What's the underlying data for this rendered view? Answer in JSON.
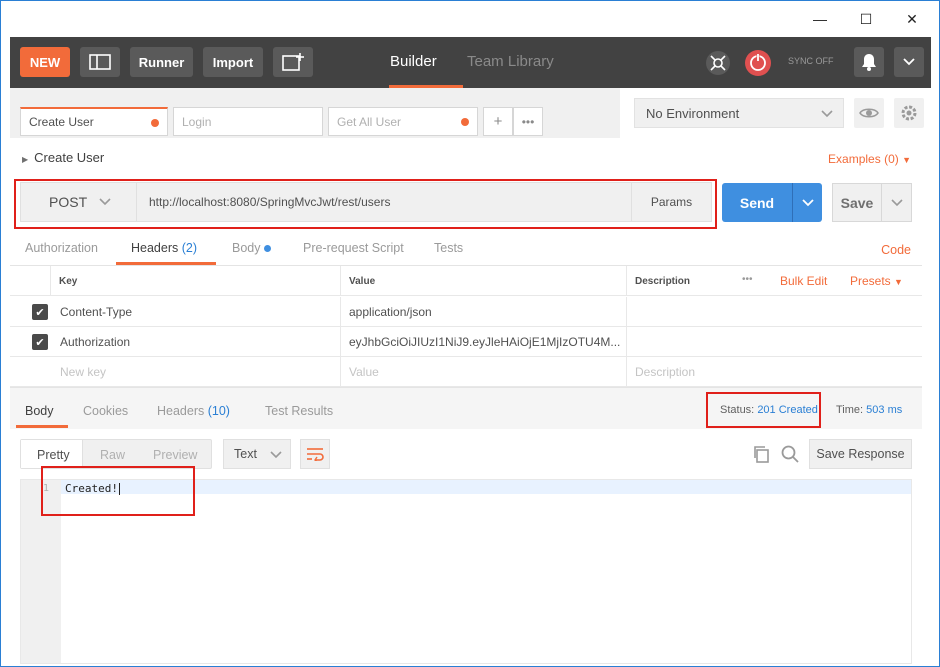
{
  "window": {
    "minimize": "—",
    "maximize": "☐",
    "close": "✕"
  },
  "toolbar": {
    "new_label": "NEW",
    "runner_label": "Runner",
    "import_label": "Import",
    "tabs": [
      {
        "label": "Builder",
        "active": true
      },
      {
        "label": "Team Library",
        "active": false
      }
    ],
    "sync_label": "SYNC OFF"
  },
  "request_tabs": [
    {
      "label": "Create User",
      "unsaved": true
    },
    {
      "label": "Login",
      "unsaved": false
    },
    {
      "label": "Get All User",
      "unsaved": true
    }
  ],
  "environment": {
    "selected": "No Environment"
  },
  "request": {
    "name": "Create User",
    "examples_label": "Examples (0)",
    "method": "POST",
    "url": "http://localhost:8080/SpringMvcJwt/rest/users",
    "params_label": "Params",
    "send_label": "Send",
    "save_label": "Save"
  },
  "sub_tabs": [
    {
      "label": "Authorization",
      "active": false
    },
    {
      "label": "Headers",
      "count": "(2)",
      "active": true
    },
    {
      "label": "Body",
      "active": false
    },
    {
      "label": "Pre-request Script",
      "active": false
    },
    {
      "label": "Tests",
      "active": false
    }
  ],
  "code_label": "Code",
  "headers_table": {
    "columns": [
      "Key",
      "Value",
      "Description"
    ],
    "more": "•••",
    "bulk_edit": "Bulk Edit",
    "presets": "Presets",
    "rows": [
      {
        "key": "Content-Type",
        "value": "application/json",
        "checked": true
      },
      {
        "key": "Authorization",
        "value": "eyJhbGciOiJIUzI1NiJ9.eyJleHAiOjE1MjIzOTU4M...",
        "checked": true
      }
    ],
    "new_key_placeholder": "New key",
    "value_placeholder": "Value",
    "description_placeholder": "Description"
  },
  "response": {
    "tabs": [
      {
        "label": "Body",
        "active": true
      },
      {
        "label": "Cookies",
        "active": false
      },
      {
        "label": "Headers",
        "count": "(10)",
        "active": false
      },
      {
        "label": "Test Results",
        "active": false
      }
    ],
    "status_label": "Status:",
    "status_value": "201 Created",
    "time_label": "Time:",
    "time_value": "503 ms",
    "view_modes": [
      "Pretty",
      "Raw",
      "Preview"
    ],
    "format": "Text",
    "save_response_label": "Save Response",
    "line_number": "1",
    "body": "Created!"
  },
  "colors": {
    "accent": "#f26b3a",
    "primary": "#3f8fe0",
    "toolbar": "#424242",
    "highlight_box": "#e0201a"
  }
}
